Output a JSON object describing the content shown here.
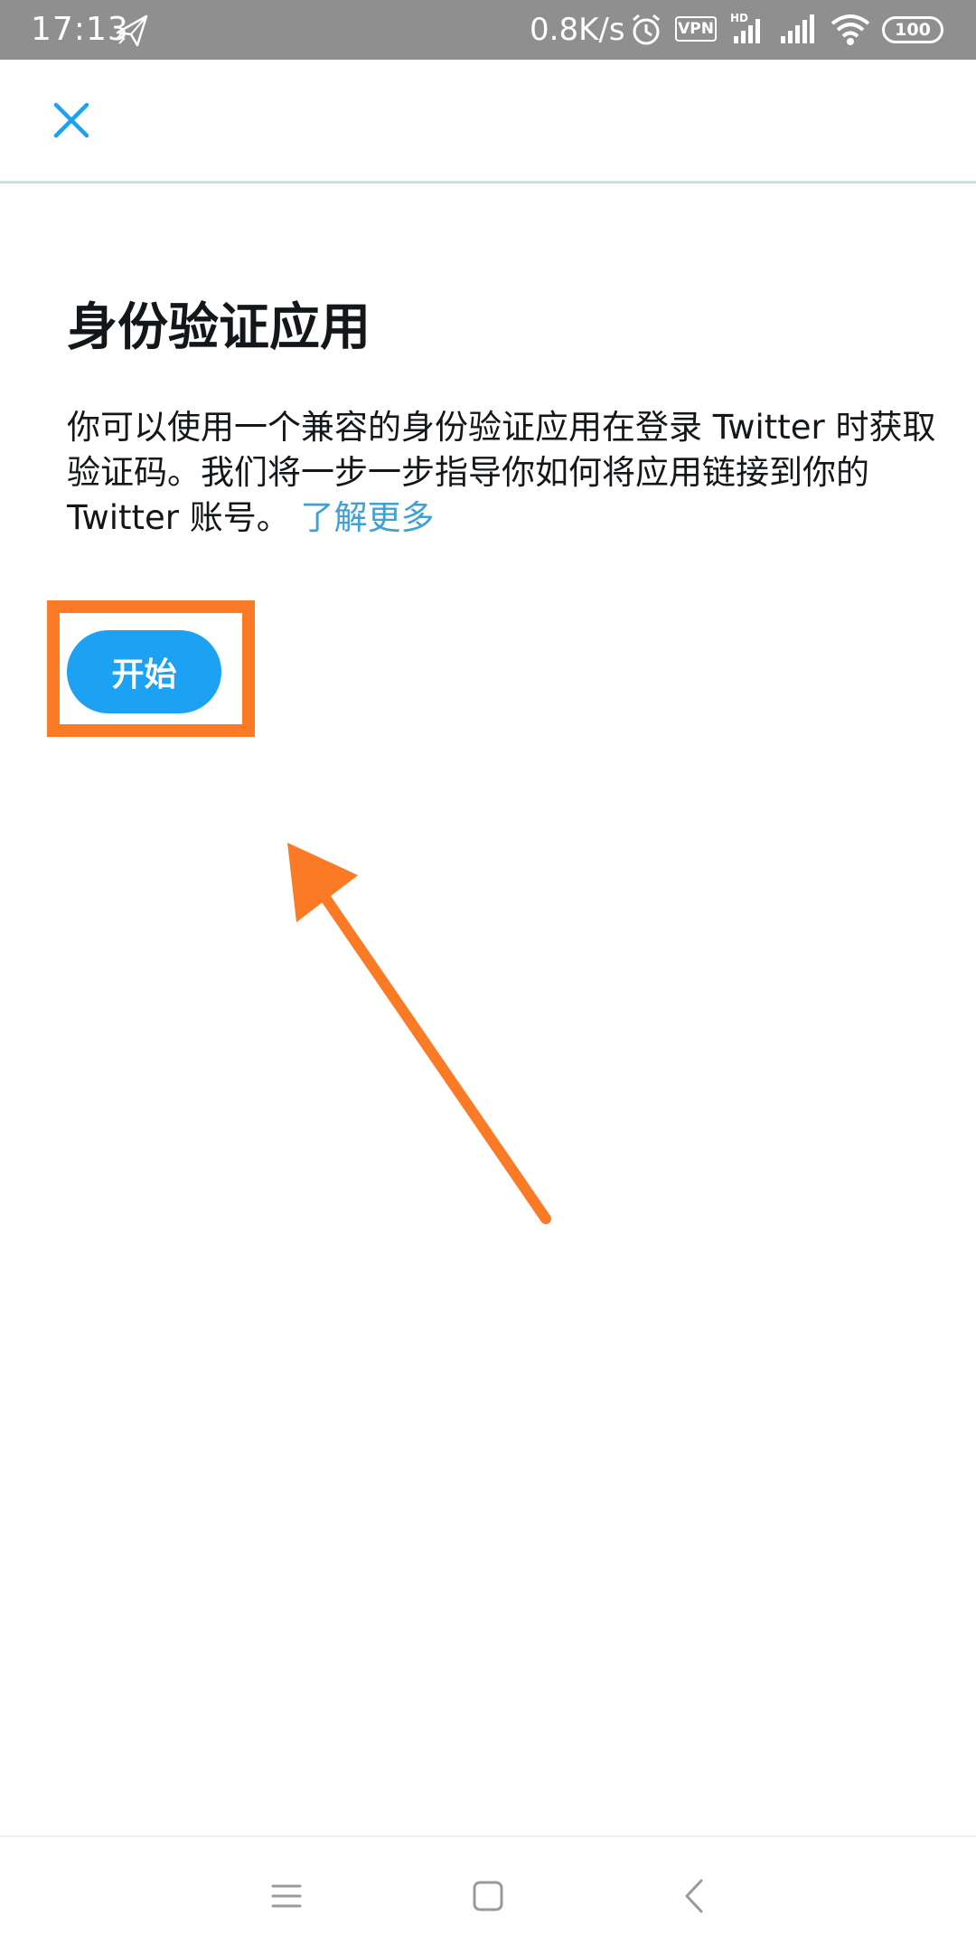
{
  "status_bar": {
    "time": "17:13",
    "network_speed": "0.8K/s",
    "vpn_label": "VPN",
    "hd_label": "HD",
    "battery": "100"
  },
  "page": {
    "title": "身份验证应用",
    "description": "你可以使用一个兼容的身份验证应用在登录 Twitter 时获取验证码。我们将一步一步指导你如何将应用链接到你的 Twitter 账号。",
    "learn_more_label": "了解更多",
    "start_button_label": "开始"
  },
  "colors": {
    "accent": "#1da1f2",
    "link": "#3ea0d4",
    "annotation": "#fb7a25"
  },
  "icons": {
    "close": "close-icon",
    "menu": "menu-icon",
    "home": "home-icon",
    "back": "back-icon"
  }
}
